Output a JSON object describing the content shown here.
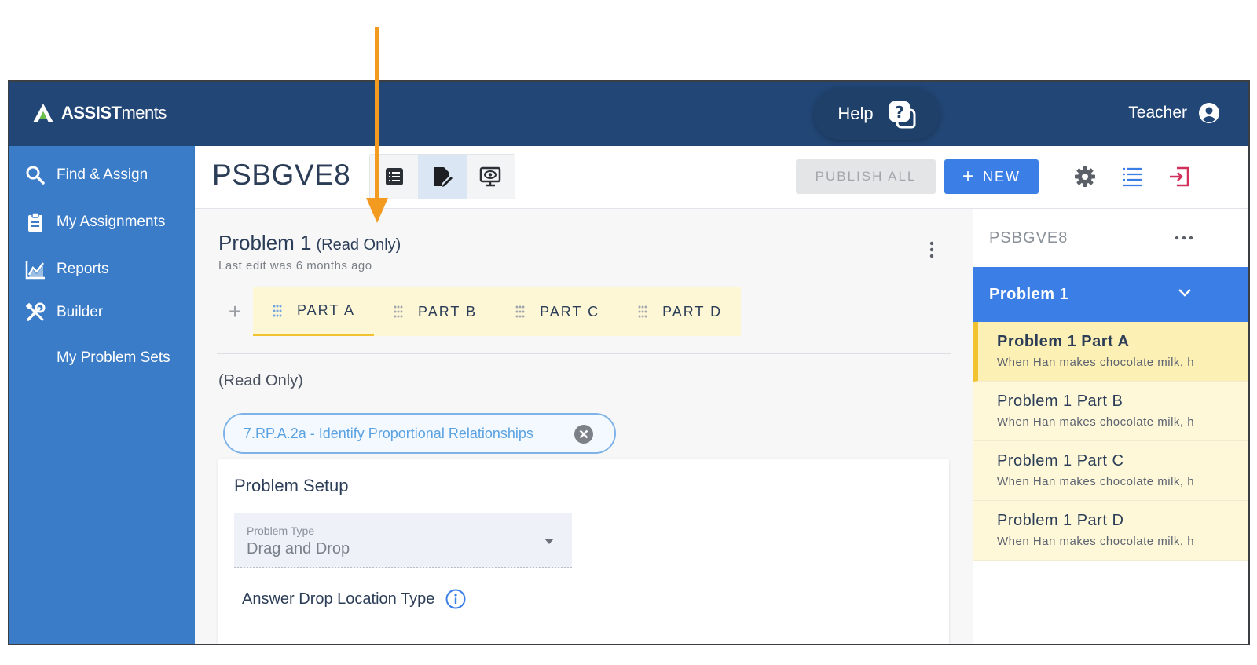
{
  "brand": {
    "name_bold": "ASSIST",
    "name_light": "ments"
  },
  "topbar": {
    "help_label": "Help",
    "user_label": "Teacher"
  },
  "sidebar": {
    "items": [
      {
        "label": "Find & Assign",
        "icon": "search-icon"
      },
      {
        "label": "My Assignments",
        "icon": "clipboard-icon"
      },
      {
        "label": "Reports",
        "icon": "chart-icon"
      },
      {
        "label": "Builder",
        "icon": "tools-icon"
      },
      {
        "label": "My Problem Sets",
        "icon": ""
      }
    ]
  },
  "header": {
    "title": "PSBGVE8",
    "view_modes": [
      "list-view-icon",
      "edit-view-icon",
      "preview-view-icon"
    ],
    "publish_label": "PUBLISH ALL",
    "new_label": "NEW",
    "tools": [
      "gear-icon",
      "list-icon",
      "exit-icon"
    ]
  },
  "problem": {
    "title": "Problem 1",
    "title_suffix": "(Read Only)",
    "last_edit": "Last edit was 6 months ago",
    "parts": [
      "PART A",
      "PART B",
      "PART C",
      "PART D"
    ],
    "active_part": "PART A",
    "read_only_label": "(Read Only)",
    "standard_chip": "7.RP.A.2a - Identify Proportional Relationships"
  },
  "setup": {
    "title": "Problem Setup",
    "problem_type_label": "Problem Type",
    "problem_type_value": "Drag and Drop",
    "drop_location_label": "Answer Drop Location Type"
  },
  "panel": {
    "code": "PSBGVE8",
    "problem_label": "Problem 1",
    "parts": [
      {
        "title": "Problem 1 Part A",
        "desc": "When Han makes chocolate milk, h"
      },
      {
        "title": "Problem 1 Part B",
        "desc": "When Han makes chocolate milk, h"
      },
      {
        "title": "Problem 1 Part C",
        "desc": "When Han makes chocolate milk, h"
      },
      {
        "title": "Problem 1 Part D",
        "desc": "When Han makes chocolate milk, h"
      }
    ]
  },
  "colors": {
    "topbar": "#224675",
    "sidebar": "#3a7cc7",
    "primary": "#3a7ee6",
    "part_bg": "#fef7d6",
    "part_accent": "#f2c230",
    "annotation_arrow": "#f39a21"
  }
}
